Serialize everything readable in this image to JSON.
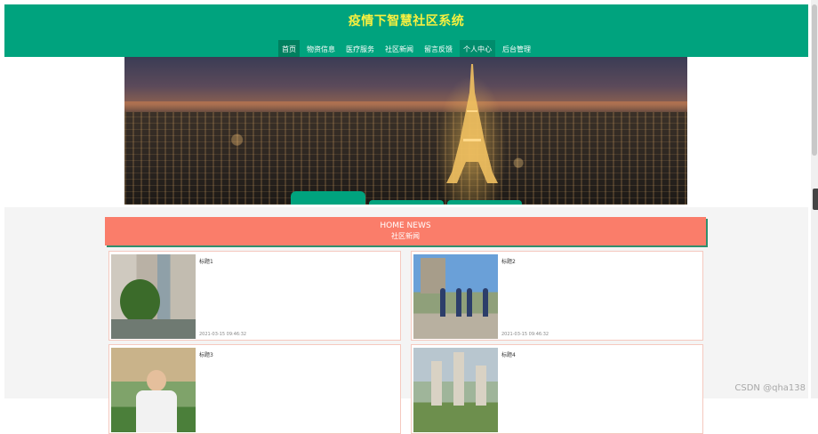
{
  "site": {
    "title": "疫情下智慧社区系统"
  },
  "nav": {
    "items": [
      {
        "label": "首页"
      },
      {
        "label": "物资信息"
      },
      {
        "label": "医疗服务"
      },
      {
        "label": "社区新闻"
      },
      {
        "label": "留言反馈"
      },
      {
        "label": "个人中心"
      },
      {
        "label": "后台管理"
      }
    ],
    "active_index": 0
  },
  "news": {
    "heading_en": "HOME NEWS",
    "heading_zh": "社区新闻",
    "items": [
      {
        "title": "标题1",
        "date": "2021-03-15 09:46:32"
      },
      {
        "title": "标题2",
        "date": "2021-03-15 09:46:32"
      },
      {
        "title": "标题3",
        "date": ""
      },
      {
        "title": "标题4",
        "date": ""
      }
    ]
  },
  "watermark": "CSDN @qha138",
  "colors": {
    "primary": "#00a37e",
    "title_yellow": "#f7f040",
    "news_header": "#fa7d6a",
    "card_border": "#f5c9bf"
  }
}
